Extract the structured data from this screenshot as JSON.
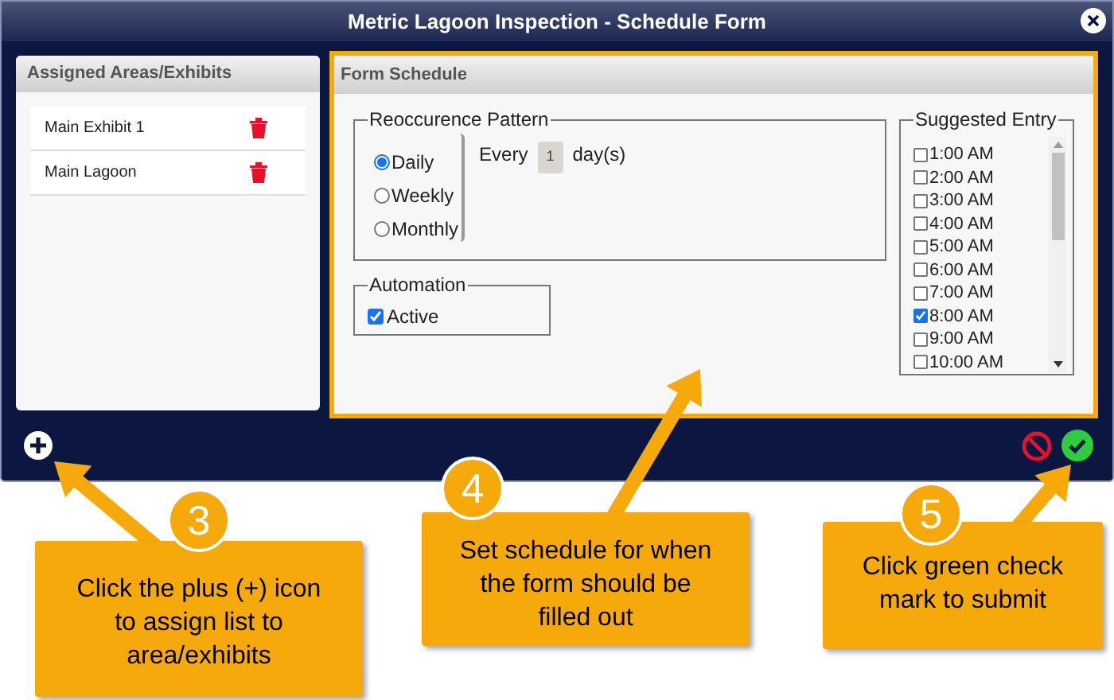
{
  "window": {
    "title": "Metric Lagoon Inspection - Schedule Form"
  },
  "assigned_panel": {
    "title": "Assigned Areas/Exhibits",
    "items": [
      {
        "label": "Main Exhibit 1"
      },
      {
        "label": "Main Lagoon"
      }
    ]
  },
  "form_panel": {
    "title": "Form Schedule"
  },
  "recurrence": {
    "legend": "Reoccurence Pattern",
    "options": [
      {
        "label": "Daily",
        "selected": true
      },
      {
        "label": "Weekly",
        "selected": false
      },
      {
        "label": "Monthly",
        "selected": false
      }
    ],
    "every_label": "Every",
    "interval": "1",
    "unit": "day(s)"
  },
  "automation": {
    "legend": "Automation",
    "label": "Active",
    "checked": true
  },
  "suggested_entry": {
    "legend": "Suggested Entry",
    "times": [
      {
        "label": "1:00 AM",
        "checked": false
      },
      {
        "label": "2:00 AM",
        "checked": false
      },
      {
        "label": "3:00 AM",
        "checked": false
      },
      {
        "label": "4:00 AM",
        "checked": false
      },
      {
        "label": "5:00 AM",
        "checked": false
      },
      {
        "label": "6:00 AM",
        "checked": false
      },
      {
        "label": "7:00 AM",
        "checked": false
      },
      {
        "label": "8:00 AM",
        "checked": true
      },
      {
        "label": "9:00 AM",
        "checked": false
      },
      {
        "label": "10:00 AM",
        "checked": false
      }
    ]
  },
  "callouts": [
    {
      "number": "3",
      "text": "Click the plus (+) icon to assign list to area/exhibits"
    },
    {
      "number": "4",
      "text": "Set schedule for when the form should be filled out"
    },
    {
      "number": "5",
      "text": "Click green check mark to submit"
    }
  ]
}
